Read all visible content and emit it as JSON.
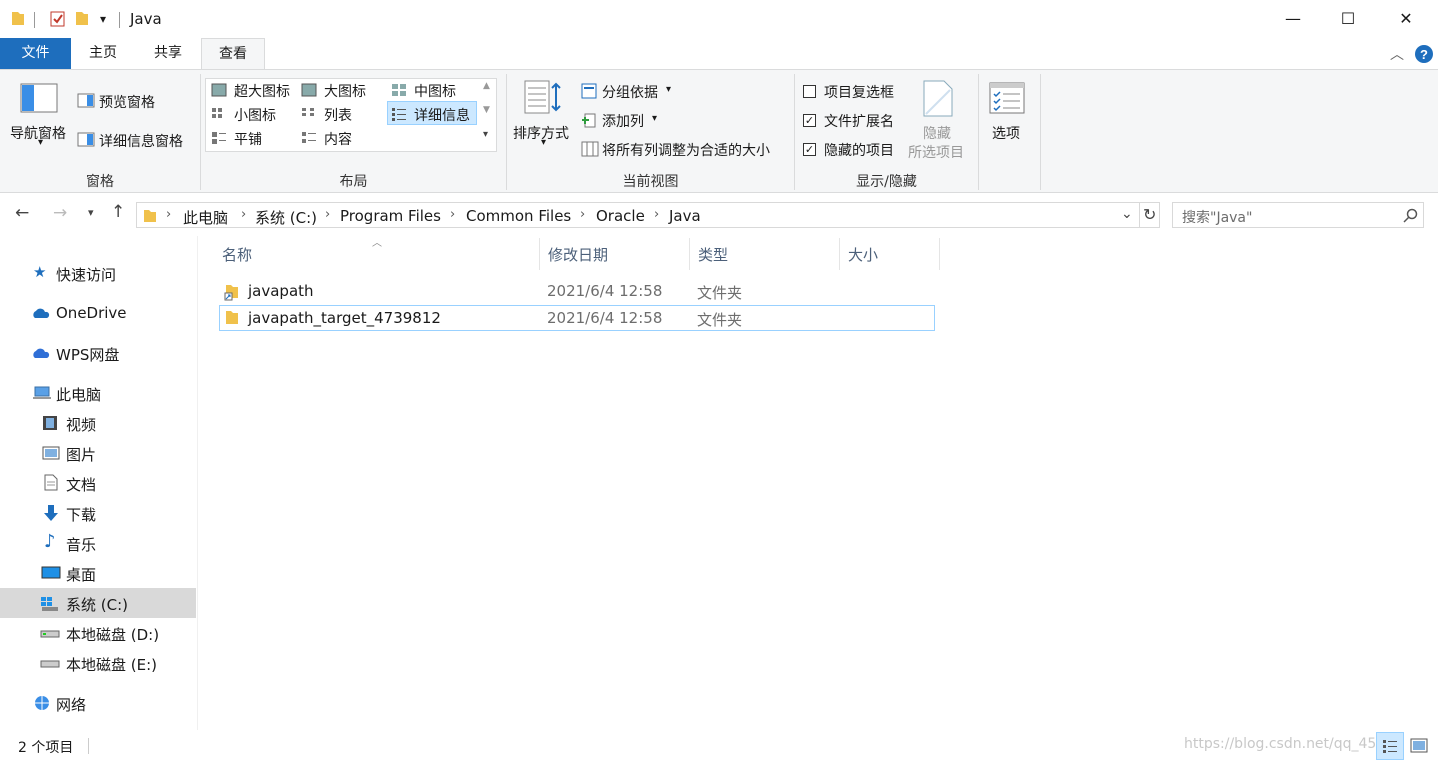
{
  "window": {
    "title": "Java",
    "minimize_glyph": "—",
    "maximize_glyph": "☐",
    "close_glyph": "✕"
  },
  "tabs": [
    {
      "label": "文件"
    },
    {
      "label": "主页"
    },
    {
      "label": "共享"
    },
    {
      "label": "查看"
    }
  ],
  "ribbon": {
    "pane_group": {
      "nav_pane": "导航窗格",
      "preview_pane": "预览窗格",
      "details_pane": "详细信息窗格",
      "label": "窗格"
    },
    "layout_group": {
      "items": [
        "超大图标",
        "大图标",
        "中图标",
        "小图标",
        "列表",
        "详细信息",
        "平铺",
        "内容"
      ],
      "selected": "详细信息",
      "label": "布局"
    },
    "view_group": {
      "sort_by": "排序方式",
      "group_by": "分组依据",
      "add_column": "添加列",
      "size_columns": "将所有列调整为合适的大小",
      "label": "当前视图"
    },
    "showhide_group": {
      "item_checkboxes": "项目复选框",
      "item_checkboxes_checked": false,
      "file_extensions": "文件扩展名",
      "file_extensions_checked": true,
      "hidden_items": "隐藏的项目",
      "hidden_items_checked": true,
      "hide_selected_line1": "隐藏",
      "hide_selected_line2": "所选项目",
      "label": "显示/隐藏"
    },
    "options": "选项"
  },
  "address": {
    "crumbs": [
      "此电脑",
      "系统 (C:)",
      "Program Files",
      "Common Files",
      "Oracle",
      "Java"
    ],
    "search_placeholder": "搜索\"Java\""
  },
  "nav": {
    "items": [
      {
        "label": "快速访问",
        "icon": "star-icon"
      },
      {
        "label": "OneDrive",
        "icon": "cloud-icon"
      },
      {
        "label": "WPS网盘",
        "icon": "cloud-icon"
      },
      {
        "label": "此电脑",
        "icon": "computer-icon"
      },
      {
        "label": "视频",
        "icon": "video-icon"
      },
      {
        "label": "图片",
        "icon": "picture-icon"
      },
      {
        "label": "文档",
        "icon": "document-icon"
      },
      {
        "label": "下载",
        "icon": "download-icon"
      },
      {
        "label": "音乐",
        "icon": "music-icon"
      },
      {
        "label": "桌面",
        "icon": "desktop-icon"
      },
      {
        "label": "系统 (C:)",
        "icon": "windows-drive-icon"
      },
      {
        "label": "本地磁盘 (D:)",
        "icon": "drive-icon"
      },
      {
        "label": "本地磁盘 (E:)",
        "icon": "drive-icon"
      },
      {
        "label": "网络",
        "icon": "network-icon"
      }
    ],
    "selected": "系统 (C:)"
  },
  "files": {
    "columns": [
      "名称",
      "修改日期",
      "类型",
      "大小"
    ],
    "rows": [
      {
        "name": "javapath",
        "modified": "2021/6/4 12:58",
        "type": "文件夹",
        "size": ""
      },
      {
        "name": "javapath_target_4739812",
        "modified": "2021/6/4 12:58",
        "type": "文件夹",
        "size": ""
      }
    ]
  },
  "status": {
    "count": "2 个项目",
    "watermark": "https://blog.csdn.net/qq_45"
  },
  "colors": {
    "file_tab": "#1e6ebd",
    "folder": "#f0c14b",
    "accent": "#0078d7"
  }
}
